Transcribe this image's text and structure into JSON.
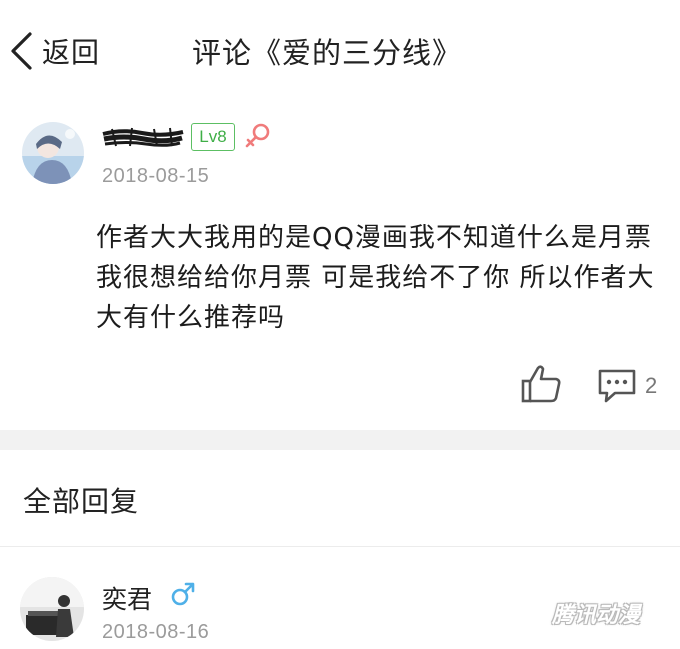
{
  "nav": {
    "back_label": "返回",
    "title": "评论《爱的三分线》"
  },
  "post": {
    "level_badge": "Lv8",
    "gender_icon": "female-icon",
    "date": "2018-08-15",
    "content": "作者大大我用的是QQ漫画我不知道什么是月票 我很想给给你月票 可是我给不了你 所以作者大大有什么推荐吗",
    "reply_count": "2"
  },
  "replies_section": {
    "title": "全部回复"
  },
  "replies": [
    {
      "name": "奕君",
      "gender_icon": "male-icon",
      "date": "2018-08-16"
    }
  ],
  "watermark": "腾讯动漫",
  "colors": {
    "level_green": "#3fae47",
    "female_pink": "#f07b7b",
    "male_blue": "#4fb0e8",
    "date_gray": "#9b9b9b",
    "band_gray": "#f2f2f2"
  }
}
